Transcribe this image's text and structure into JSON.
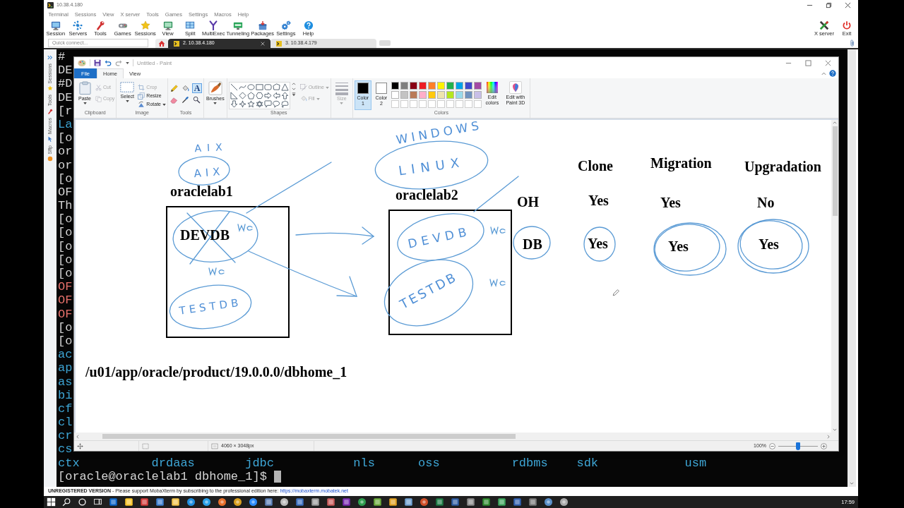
{
  "window": {
    "title": "10.38.4.180"
  },
  "menu": [
    "Terminal",
    "Sessions",
    "View",
    "X server",
    "Tools",
    "Games",
    "Settings",
    "Macros",
    "Help"
  ],
  "toolbar": {
    "buttons": [
      "Session",
      "Servers",
      "Tools",
      "Games",
      "Sessions",
      "View",
      "Split",
      "MultiExec",
      "Tunneling",
      "Packages",
      "Settings",
      "Help"
    ],
    "right_buttons": [
      "X server",
      "Exit"
    ]
  },
  "quick_connect": {
    "placeholder": "Quick connect..."
  },
  "tabs": [
    {
      "label": "2. 10.38.4.180",
      "selected": true
    },
    {
      "label": "3. 10.38.4.179",
      "selected": false
    }
  ],
  "sidebar": {
    "tabs": [
      "Sessions",
      "Tools",
      "Macros",
      "Sftp"
    ]
  },
  "terminal": {
    "lines": [
      {
        "text": "#",
        "color": "#d6d6d6"
      },
      {
        "text": "DE",
        "color": "#d6d6d6"
      },
      {
        "text": "#D",
        "color": "#d6d6d6"
      },
      {
        "text": "DE",
        "color": "#d6d6d6"
      },
      {
        "text": "[r",
        "color": "#d6d6d6"
      },
      {
        "text": "La",
        "color": "#3ea6d6"
      },
      {
        "text": "[o",
        "color": "#d6d6d6"
      },
      {
        "text": "or",
        "color": "#d6d6d6"
      },
      {
        "text": "or",
        "color": "#d6d6d6"
      },
      {
        "text": "[o",
        "color": "#d6d6d6"
      },
      {
        "text": "OF",
        "color": "#d6d6d6"
      },
      {
        "text": "Th",
        "color": "#d6d6d6"
      },
      {
        "text": "[o",
        "color": "#d6d6d6"
      },
      {
        "text": "[o",
        "color": "#d6d6d6"
      },
      {
        "text": "[o",
        "color": "#d6d6d6"
      },
      {
        "text": "[o",
        "color": "#d6d6d6"
      },
      {
        "text": "[o",
        "color": "#d6d6d6"
      },
      {
        "text": "OF",
        "color": "#e8716b"
      },
      {
        "text": "OF",
        "color": "#e8716b"
      },
      {
        "text": "OF",
        "color": "#e8716b"
      },
      {
        "text": "[o",
        "color": "#d6d6d6"
      },
      {
        "text": "[o",
        "color": "#d6d6d6"
      },
      {
        "text": "ac",
        "color": "#3ea6d6"
      },
      {
        "text": "ap",
        "color": "#3ea6d6"
      },
      {
        "text": "as",
        "color": "#3ea6d6"
      },
      {
        "text": "bi",
        "color": "#3ea6d6"
      },
      {
        "text": "cf",
        "color": "#3ea6d6"
      },
      {
        "text": "cl",
        "color": "#3ea6d6"
      },
      {
        "text": "cr",
        "color": "#3ea6d6"
      },
      {
        "text": "cs",
        "color": "#3ea6d6"
      }
    ],
    "listing": [
      [
        {
          "text": "ctx",
          "color": "#3ea6d6"
        },
        {
          "text": "drdaas",
          "color": "#3ea6d6"
        },
        {
          "text": "jdbc",
          "color": "#3ea6d6"
        },
        {
          "text": "nls",
          "color": "#3ea6d6"
        },
        {
          "text": "oss",
          "color": "#3ea6d6"
        },
        {
          "text": "rdbms",
          "color": "#3ea6d6"
        },
        {
          "text": "sdk",
          "color": "#3ea6d6"
        },
        {
          "text": "usm",
          "color": "#3ea6d6"
        }
      ]
    ],
    "prompt": {
      "text": "[oracle@oraclelab1 dbhome_1]$",
      "cursor": true
    }
  },
  "paint": {
    "title": "Untitled - Paint",
    "ribbon_tabs": [
      {
        "label": "File",
        "kind": "menu",
        "selected": false
      },
      {
        "label": "Home",
        "kind": "tab",
        "selected": true
      },
      {
        "label": "View",
        "kind": "tab",
        "selected": false
      }
    ],
    "clipboard": {
      "label": "Clipboard",
      "paste": "Paste",
      "actions": [
        {
          "label": "Cut",
          "disabled": true
        },
        {
          "label": "Copy",
          "disabled": true
        }
      ]
    },
    "image": {
      "label": "Image",
      "select": "Select",
      "actions": [
        {
          "label": "Crop",
          "disabled": true
        },
        {
          "label": "Resize",
          "disabled": false
        },
        {
          "label": "Rotate",
          "disabled": false
        }
      ]
    },
    "tools": {
      "label": "Tools",
      "items": [
        {
          "selected": false
        },
        {
          "selected": false
        },
        {
          "glyph": "A",
          "selected": true
        },
        {
          "selected": false
        },
        {
          "selected": false
        },
        {
          "selected": false
        }
      ]
    },
    "brushes": {
      "label": "Brushes"
    },
    "shapes": {
      "label": "Shapes",
      "outline": {
        "label": "Outline",
        "disabled": true
      },
      "fill": {
        "label": "Fill",
        "disabled": true
      }
    },
    "size": {
      "label": "Size",
      "disabled": true
    },
    "colors": {
      "label": "Colors",
      "slots": [
        {
          "label": "Color 1",
          "color": "#000000",
          "selected": true
        },
        {
          "label": "Color 2",
          "color": "#ffffff",
          "selected": false
        }
      ],
      "palette": [
        {
          "color": "#000000"
        },
        {
          "color": "#7f7f7f"
        },
        {
          "color": "#880015"
        },
        {
          "color": "#ed1c24"
        },
        {
          "color": "#ff7f27"
        },
        {
          "color": "#fff200"
        },
        {
          "color": "#22b14c"
        },
        {
          "color": "#00a2e8"
        },
        {
          "color": "#3f48cc"
        },
        {
          "color": "#a349a4"
        },
        {
          "color": "#ffffff"
        },
        {
          "color": "#c3c3c3"
        },
        {
          "color": "#b97a57"
        },
        {
          "color": "#ffaec9"
        },
        {
          "color": "#ffc90e"
        },
        {
          "color": "#efe4b0"
        },
        {
          "color": "#b5e61d"
        },
        {
          "color": "#99d9ea"
        },
        {
          "color": "#7092be"
        },
        {
          "color": "#c8bfe7"
        }
      ],
      "edit": "Edit colors",
      "paint3d": "Edit with Paint 3D"
    },
    "canvas": {
      "labels": [
        "Clone",
        "Migration",
        "Upgradation",
        "oraclelab1",
        "oraclelab2",
        "OH",
        "Yes",
        "Yes",
        "No",
        "DEVDB",
        "DB",
        "Yes",
        "Yes",
        "Yes",
        "/u01/app/oracle/product/19.0.0.0/dbhome_1"
      ],
      "handwriting": [
        "AIX",
        "AIX",
        "WINDOWS",
        "LINUX",
        "DEVDB",
        "TESTDB",
        "TESTDB"
      ]
    },
    "status": {
      "dimensions": "4060 × 3048px",
      "zoom": "100%",
      "zoom_slider": {
        "level": 0.5
      }
    }
  },
  "status_bar": {
    "message": "**UNREGISTERED VERSION** - Please support MobaXterm by subscribing to the professional edition here:",
    "link": "https://mobaxterm.mobatek.net"
  },
  "taskbar": {
    "clock": "17:59"
  }
}
